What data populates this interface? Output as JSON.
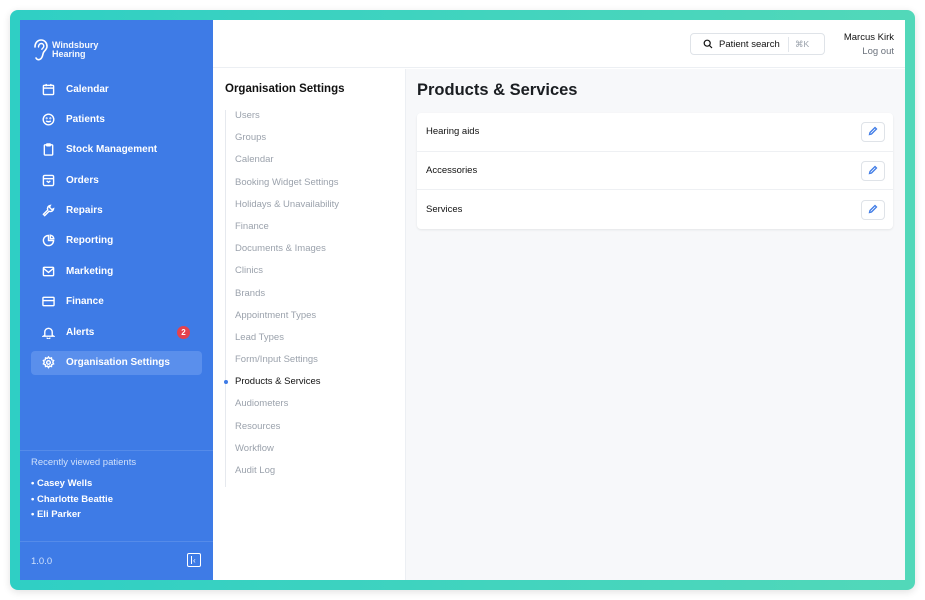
{
  "brand": {
    "line1": "Windsbury",
    "line2": "Hearing"
  },
  "nav": [
    {
      "label": "Calendar",
      "icon": "calendar-icon"
    },
    {
      "label": "Patients",
      "icon": "smile-icon"
    },
    {
      "label": "Stock Management",
      "icon": "clipboard-icon"
    },
    {
      "label": "Orders",
      "icon": "box-icon"
    },
    {
      "label": "Repairs",
      "icon": "wrench-icon"
    },
    {
      "label": "Reporting",
      "icon": "pie-chart-icon"
    },
    {
      "label": "Marketing",
      "icon": "mail-icon"
    },
    {
      "label": "Finance",
      "icon": "credit-card-icon"
    },
    {
      "label": "Alerts",
      "icon": "bell-icon",
      "badge": "2"
    },
    {
      "label": "Organisation Settings",
      "icon": "gear-icon",
      "active": true
    }
  ],
  "recent": {
    "title": "Recently viewed patients",
    "items": [
      "• Casey Wells",
      "• Charlotte Beattie",
      "• Eli Parker"
    ]
  },
  "version": "1.0.0",
  "topbar": {
    "search_label": "Patient search",
    "search_shortcut": "⌘K",
    "user_name": "Marcus Kirk",
    "logout": "Log out"
  },
  "settings": {
    "title": "Organisation Settings",
    "items": [
      "Users",
      "Groups",
      "Calendar",
      "Booking Widget Settings",
      "Holidays & Unavailability",
      "Finance",
      "Documents & Images",
      "Clinics",
      "Brands",
      "Appointment Types",
      "Lead Types",
      "Form/Input Settings",
      "Products & Services",
      "Audiometers",
      "Resources",
      "Workflow",
      "Audit Log"
    ],
    "active": "Products & Services"
  },
  "panel": {
    "title": "Products & Services",
    "rows": [
      "Hearing aids",
      "Accessories",
      "Services"
    ]
  },
  "colors": {
    "sidebar": "#3e7be6",
    "frame": "#2fcfc4",
    "badge": "#e5424d"
  }
}
